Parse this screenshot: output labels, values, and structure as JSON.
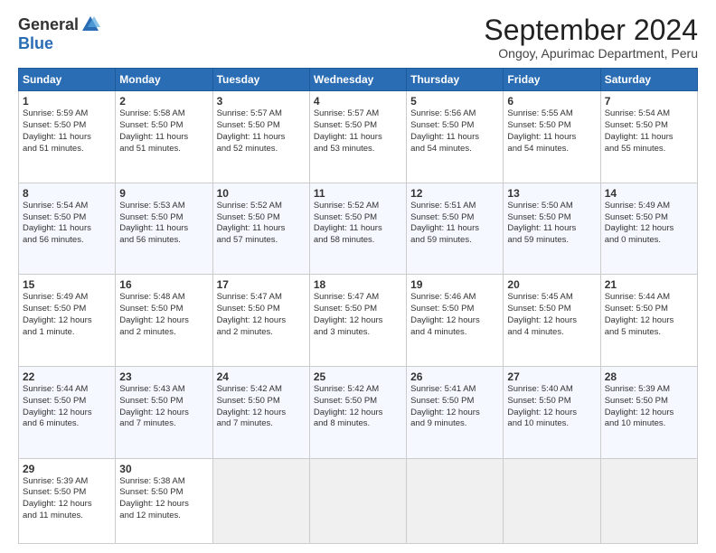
{
  "logo": {
    "general": "General",
    "blue": "Blue"
  },
  "title": "September 2024",
  "location": "Ongoy, Apurimac Department, Peru",
  "days_header": [
    "Sunday",
    "Monday",
    "Tuesday",
    "Wednesday",
    "Thursday",
    "Friday",
    "Saturday"
  ],
  "weeks": [
    [
      {
        "day": "1",
        "content": "Sunrise: 5:59 AM\nSunset: 5:50 PM\nDaylight: 11 hours\nand 51 minutes."
      },
      {
        "day": "2",
        "content": "Sunrise: 5:58 AM\nSunset: 5:50 PM\nDaylight: 11 hours\nand 51 minutes."
      },
      {
        "day": "3",
        "content": "Sunrise: 5:57 AM\nSunset: 5:50 PM\nDaylight: 11 hours\nand 52 minutes."
      },
      {
        "day": "4",
        "content": "Sunrise: 5:57 AM\nSunset: 5:50 PM\nDaylight: 11 hours\nand 53 minutes."
      },
      {
        "day": "5",
        "content": "Sunrise: 5:56 AM\nSunset: 5:50 PM\nDaylight: 11 hours\nand 54 minutes."
      },
      {
        "day": "6",
        "content": "Sunrise: 5:55 AM\nSunset: 5:50 PM\nDaylight: 11 hours\nand 54 minutes."
      },
      {
        "day": "7",
        "content": "Sunrise: 5:54 AM\nSunset: 5:50 PM\nDaylight: 11 hours\nand 55 minutes."
      }
    ],
    [
      {
        "day": "8",
        "content": "Sunrise: 5:54 AM\nSunset: 5:50 PM\nDaylight: 11 hours\nand 56 minutes."
      },
      {
        "day": "9",
        "content": "Sunrise: 5:53 AM\nSunset: 5:50 PM\nDaylight: 11 hours\nand 56 minutes."
      },
      {
        "day": "10",
        "content": "Sunrise: 5:52 AM\nSunset: 5:50 PM\nDaylight: 11 hours\nand 57 minutes."
      },
      {
        "day": "11",
        "content": "Sunrise: 5:52 AM\nSunset: 5:50 PM\nDaylight: 11 hours\nand 58 minutes."
      },
      {
        "day": "12",
        "content": "Sunrise: 5:51 AM\nSunset: 5:50 PM\nDaylight: 11 hours\nand 59 minutes."
      },
      {
        "day": "13",
        "content": "Sunrise: 5:50 AM\nSunset: 5:50 PM\nDaylight: 11 hours\nand 59 minutes."
      },
      {
        "day": "14",
        "content": "Sunrise: 5:49 AM\nSunset: 5:50 PM\nDaylight: 12 hours\nand 0 minutes."
      }
    ],
    [
      {
        "day": "15",
        "content": "Sunrise: 5:49 AM\nSunset: 5:50 PM\nDaylight: 12 hours\nand 1 minute."
      },
      {
        "day": "16",
        "content": "Sunrise: 5:48 AM\nSunset: 5:50 PM\nDaylight: 12 hours\nand 2 minutes."
      },
      {
        "day": "17",
        "content": "Sunrise: 5:47 AM\nSunset: 5:50 PM\nDaylight: 12 hours\nand 2 minutes."
      },
      {
        "day": "18",
        "content": "Sunrise: 5:47 AM\nSunset: 5:50 PM\nDaylight: 12 hours\nand 3 minutes."
      },
      {
        "day": "19",
        "content": "Sunrise: 5:46 AM\nSunset: 5:50 PM\nDaylight: 12 hours\nand 4 minutes."
      },
      {
        "day": "20",
        "content": "Sunrise: 5:45 AM\nSunset: 5:50 PM\nDaylight: 12 hours\nand 4 minutes."
      },
      {
        "day": "21",
        "content": "Sunrise: 5:44 AM\nSunset: 5:50 PM\nDaylight: 12 hours\nand 5 minutes."
      }
    ],
    [
      {
        "day": "22",
        "content": "Sunrise: 5:44 AM\nSunset: 5:50 PM\nDaylight: 12 hours\nand 6 minutes."
      },
      {
        "day": "23",
        "content": "Sunrise: 5:43 AM\nSunset: 5:50 PM\nDaylight: 12 hours\nand 7 minutes."
      },
      {
        "day": "24",
        "content": "Sunrise: 5:42 AM\nSunset: 5:50 PM\nDaylight: 12 hours\nand 7 minutes."
      },
      {
        "day": "25",
        "content": "Sunrise: 5:42 AM\nSunset: 5:50 PM\nDaylight: 12 hours\nand 8 minutes."
      },
      {
        "day": "26",
        "content": "Sunrise: 5:41 AM\nSunset: 5:50 PM\nDaylight: 12 hours\nand 9 minutes."
      },
      {
        "day": "27",
        "content": "Sunrise: 5:40 AM\nSunset: 5:50 PM\nDaylight: 12 hours\nand 10 minutes."
      },
      {
        "day": "28",
        "content": "Sunrise: 5:39 AM\nSunset: 5:50 PM\nDaylight: 12 hours\nand 10 minutes."
      }
    ],
    [
      {
        "day": "29",
        "content": "Sunrise: 5:39 AM\nSunset: 5:50 PM\nDaylight: 12 hours\nand 11 minutes."
      },
      {
        "day": "30",
        "content": "Sunrise: 5:38 AM\nSunset: 5:50 PM\nDaylight: 12 hours\nand 12 minutes."
      },
      {
        "day": "",
        "content": ""
      },
      {
        "day": "",
        "content": ""
      },
      {
        "day": "",
        "content": ""
      },
      {
        "day": "",
        "content": ""
      },
      {
        "day": "",
        "content": ""
      }
    ]
  ]
}
